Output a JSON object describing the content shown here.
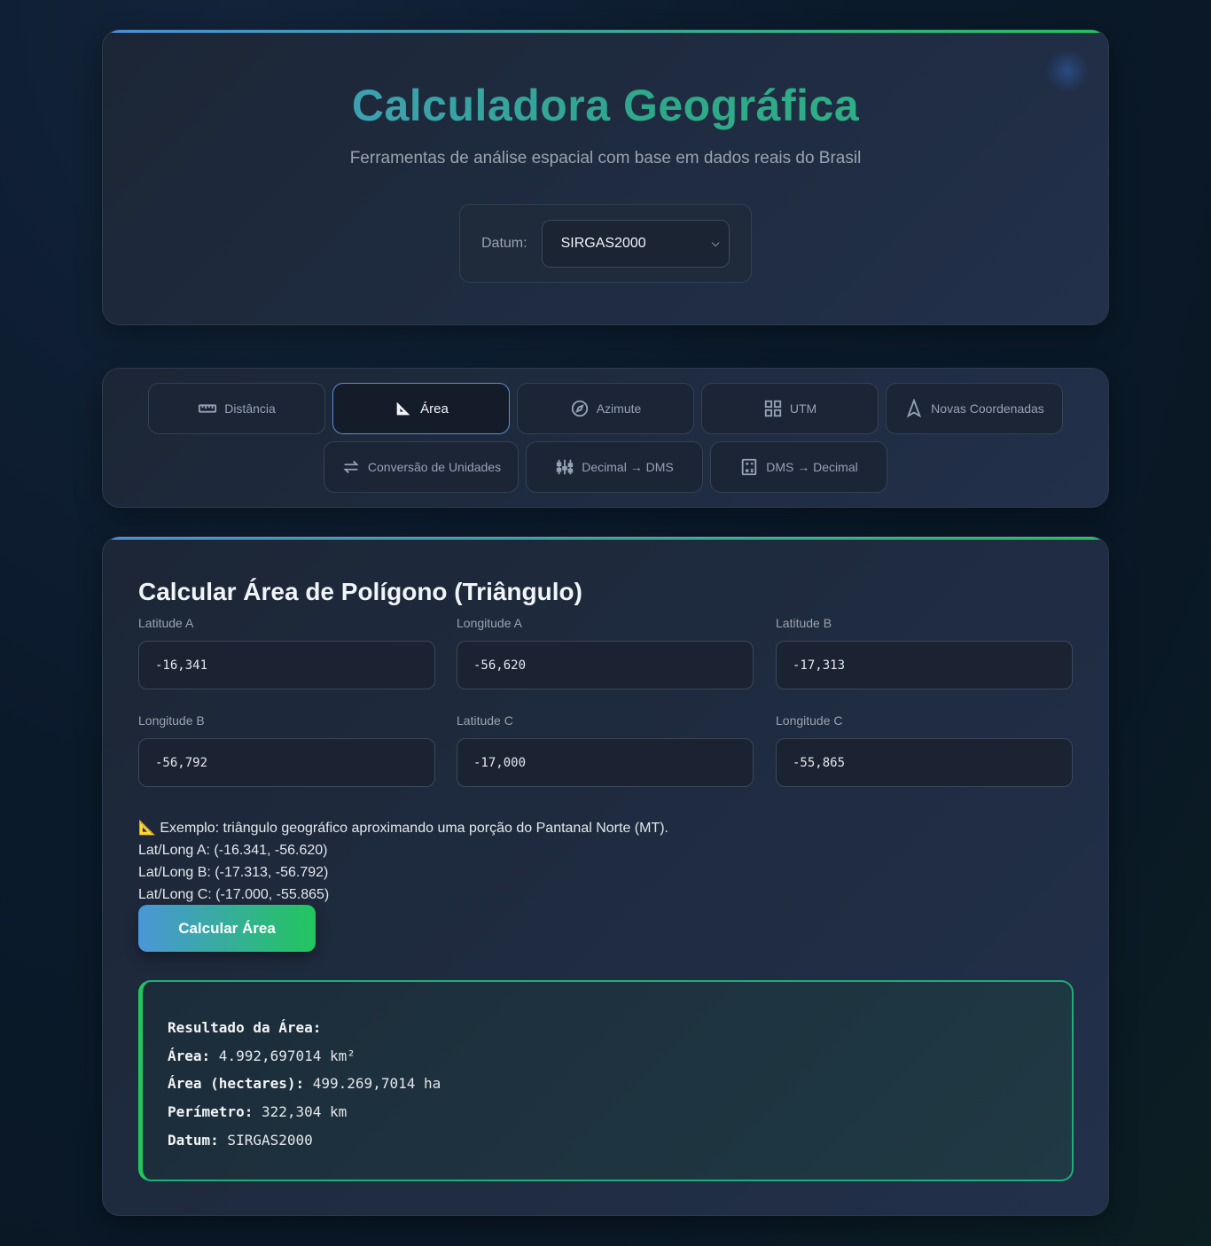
{
  "header": {
    "title": "Calculadora Geográfica",
    "subtitle": "Ferramentas de análise espacial com base em dados reais do Brasil",
    "datum_label": "Datum:",
    "datum_value": "SIRGAS2000"
  },
  "tabs": [
    {
      "label": "Distância",
      "icon": "ruler-icon",
      "active": false
    },
    {
      "label": "Área",
      "icon": "set-square-icon",
      "active": true
    },
    {
      "label": "Azimute",
      "icon": "compass-icon",
      "active": false
    },
    {
      "label": "UTM",
      "icon": "grid-icon",
      "active": false
    },
    {
      "label": "Novas Coordenadas",
      "icon": "navigation-arrow-icon",
      "active": false
    },
    {
      "label": "Conversão de Unidades",
      "icon": "swap-arrows-icon",
      "active": false
    },
    {
      "label": "Decimal → DMS",
      "icon": "abacus-icon",
      "active": false
    },
    {
      "label": "DMS → Decimal",
      "icon": "calculator-icon",
      "active": false
    }
  ],
  "form": {
    "title": "Calcular Área de Polígono (Triângulo)",
    "fields": [
      {
        "label": "Latitude A",
        "value": "-16,341"
      },
      {
        "label": "Longitude A",
        "value": "-56,620"
      },
      {
        "label": "Latitude B",
        "value": "-17,313"
      },
      {
        "label": "Longitude B",
        "value": "-56,792"
      },
      {
        "label": "Latitude C",
        "value": "-17,000"
      },
      {
        "label": "Longitude C",
        "value": "-55,865"
      }
    ],
    "example_lines": [
      "📐 Exemplo: triângulo geográfico aproximando uma porção do Pantanal Norte (MT).",
      "Lat/Long A: (-16.341, -56.620)",
      "Lat/Long B: (-17.313, -56.792)",
      "Lat/Long C: (-17.000, -55.865)"
    ],
    "button_label": "Calcular Área"
  },
  "result": {
    "heading": "Resultado da Área:",
    "rows": [
      {
        "key": "Área:",
        "value": " 4.992,697014 km²"
      },
      {
        "key": "Área (hectares):",
        "value": " 499.269,7014 ha"
      },
      {
        "key": "Perímetro:",
        "value": " 322,304 km"
      },
      {
        "key": "Datum:",
        "value": " SIRGAS2000"
      }
    ]
  },
  "colors": {
    "accent_start": "#4a90d9",
    "accent_end": "#22c55e",
    "result_border": "#1fae78"
  }
}
